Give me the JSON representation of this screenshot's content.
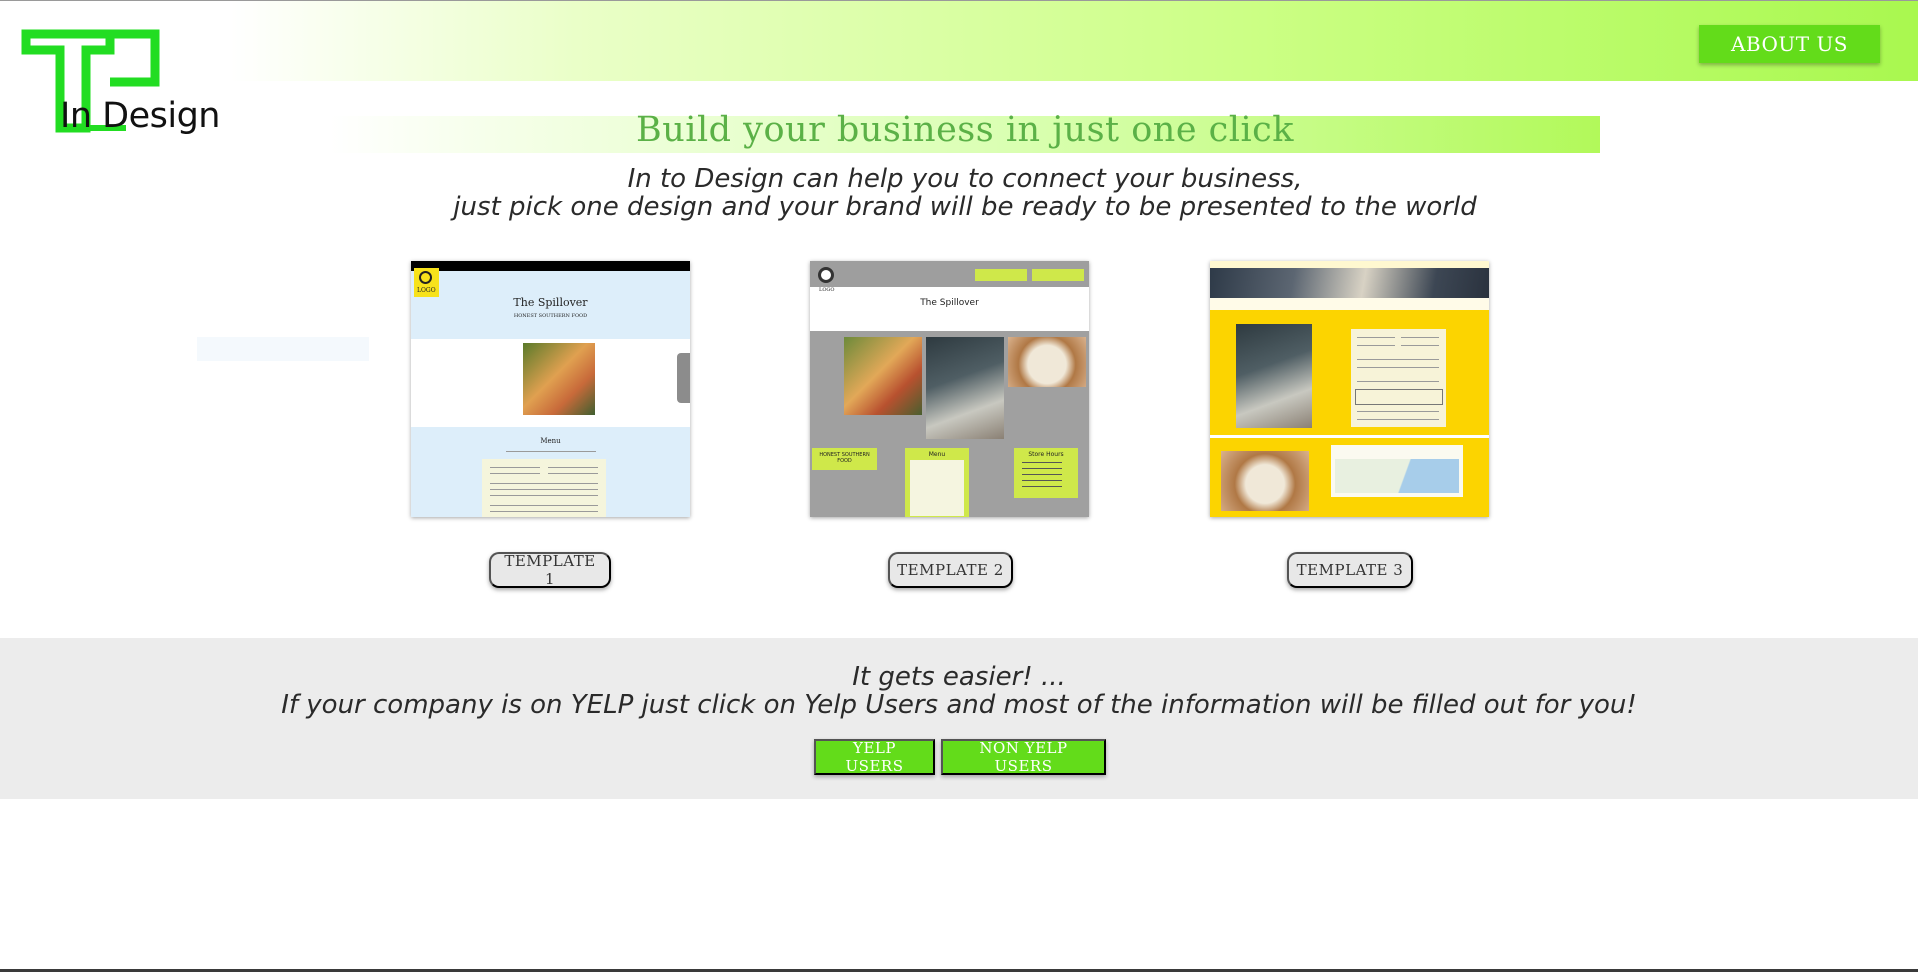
{
  "header": {
    "logo_text": "In Design",
    "about_label": "ABOUT US"
  },
  "hero": {
    "headline": "Build your business in just one click",
    "sub_line1": "In to Design can help you to connect your business,",
    "sub_line2": "just pick one design and your brand will be ready to be presented to the world"
  },
  "templates": [
    {
      "label": "TEMPLATE 1",
      "site_name": "The Spillover",
      "tagline": "HONEST SOUTHERN FOOD",
      "menu_title": "Menu",
      "logo": "LOGO"
    },
    {
      "label": "TEMPLATE 2",
      "site_name": "The Spillover",
      "logo": "LOGO",
      "box1": "HONEST SOUTHERN FOOD",
      "box2": "Menu",
      "box3": "Store Hours"
    },
    {
      "label": "TEMPLATE 3"
    }
  ],
  "yelp": {
    "line1": "It gets easier! ...",
    "line2": "If your company is on YELP just click on Yelp Users and most of the information will be filled out for you!",
    "yelp_label": "YELP USERS",
    "non_yelp_label": "NON YELP USERS"
  },
  "colors": {
    "accent_green": "#63dc1a",
    "headline_green": "#5bb147",
    "logo_green": "#22dd22"
  },
  "icons": {
    "logo": "in-design-logo-icon"
  }
}
